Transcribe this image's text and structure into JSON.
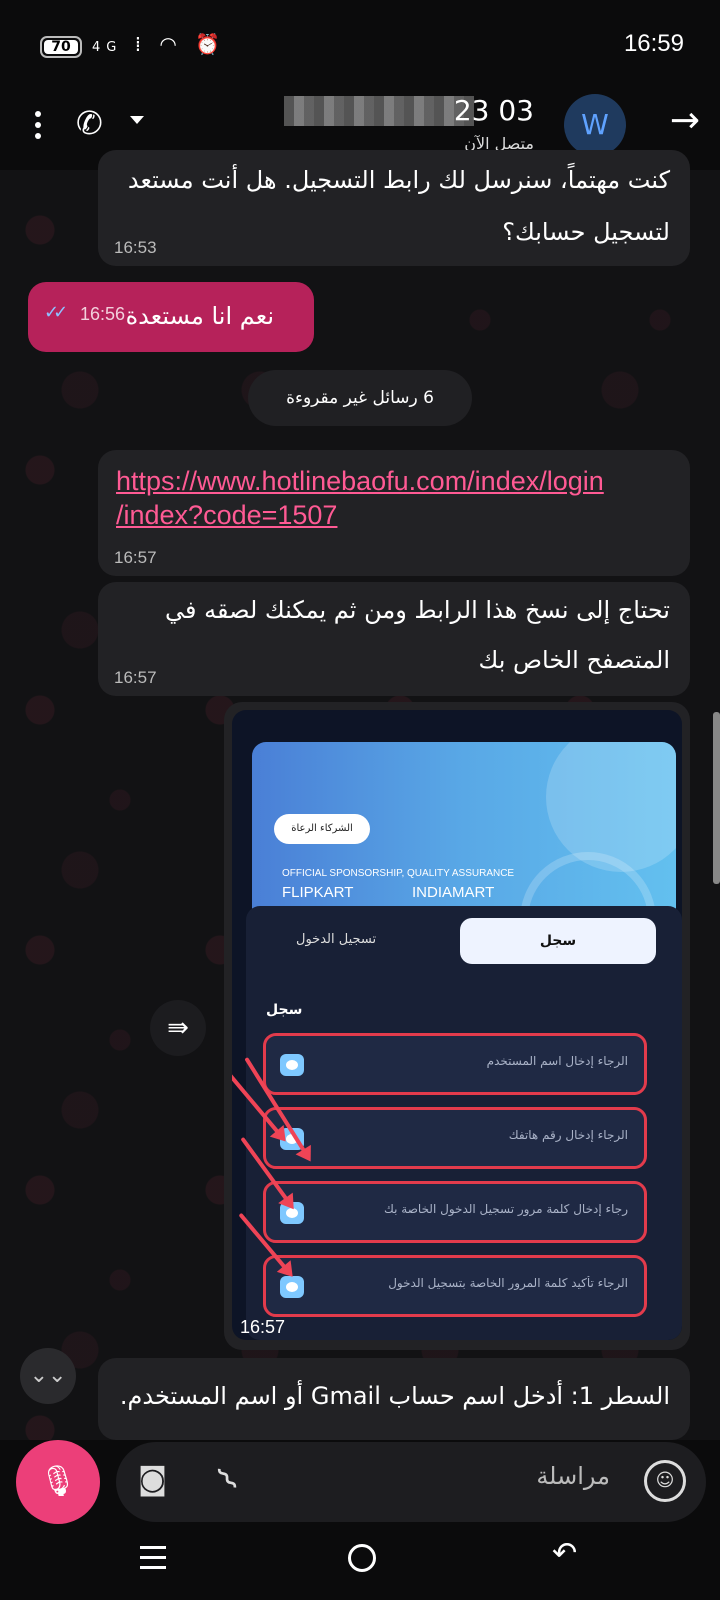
{
  "status_bar": {
    "battery": "70",
    "network": "4G",
    "time": "16:59"
  },
  "header": {
    "contact_name": "23 03",
    "contact_status": "متصل الآن",
    "avatar_letter": "W"
  },
  "messages": [
    {
      "type": "received",
      "text_line1": "كنت مهتماً، سنرسل لك رابط التسجيل. هل أنت مستعد",
      "text_line2": "لتسجيل حسابك؟",
      "time": "16:53"
    },
    {
      "type": "sent",
      "text": "نعم انا مستعدة",
      "time": "16:56"
    },
    {
      "type": "received-link",
      "link_line1": "https://www.hotlinebaofu.com/index/login",
      "link_line2": "/index?code=1507",
      "time": "16:57"
    },
    {
      "type": "received",
      "text_line1": "تحتاج إلى نسخ هذا الرابط ومن ثم يمكنك لصقه في",
      "text_line2": "المتصفح الخاص بك",
      "time": "16:57"
    },
    {
      "type": "received-image",
      "time": "16:57"
    },
    {
      "type": "received",
      "text": "السطر 1: أدخل اسم حساب Gmail أو اسم المستخدم."
    }
  ],
  "unread_divider": "6 رسائل غير مقروءة",
  "shared_image": {
    "tag": "الشركاء الرعاة",
    "sponsorship": "OFFICIAL SPONSORSHIP, QUALITY ASSURANCE",
    "brand_left": "FLIPKART",
    "brand_right": "INDIAMART",
    "tab_register": "سجل",
    "tab_login": "تسجيل الدخول",
    "form_title": "سجل",
    "fields": [
      "الرجاء إدخال اسم المستخدم",
      "الرجاء إدخال رقم هاتفك",
      "رجاء إدخال كلمة مرور تسجيل الدخول الخاصة بك",
      "الرجاء تأكيد كلمة المرور الخاصة بتسجيل الدخول"
    ]
  },
  "composer": {
    "placeholder": "مراسلة"
  },
  "colors": {
    "sent_bubble": "#b6225a",
    "received_bubble": "#222225",
    "link": "#ff5a94",
    "mic": "#ec3f79",
    "avatar": "#1f3a5e"
  },
  "icons": [
    "menu-dots-icon",
    "phone-icon",
    "back-arrow-icon",
    "forward-icon",
    "scroll-down-icon",
    "mic-icon",
    "camera-icon",
    "attach-icon",
    "sticker-icon",
    "double-check-icon"
  ]
}
